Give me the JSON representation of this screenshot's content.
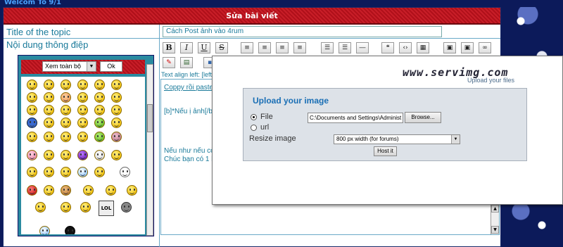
{
  "header": {
    "title": "Welcom To 9/1"
  },
  "panel": {
    "title": "Sửa bài viết"
  },
  "topic": {
    "label": "Title of the topic",
    "value": "Cách Post ảnh vào 4rum"
  },
  "message": {
    "label": "Nội dung thông điệp"
  },
  "toolbar": {
    "bold": "B",
    "italic": "I",
    "underline": "U",
    "strike": "S"
  },
  "emoticons": {
    "select_value": "Xem toàn bộ",
    "ok_label": "Ok",
    "picture_label": "LOL"
  },
  "editor": {
    "align_hint": "Text align left: [left",
    "lines": [
      "Coppy rồi paste",
      "[b]*Nếu ị ảnh[/b",
      "Nếu như nếu còn",
      "Chúc bạn có 1 bài"
    ]
  },
  "popup": {
    "logo": "www.servimg.com",
    "logo_sub": "Upload your files",
    "title": "Upload your image",
    "file_label": "File",
    "file_path": "C:\\Documents and Settings\\Administ",
    "browse_label": "Browse...",
    "url_label": "url",
    "resize_label": "Resize image",
    "resize_value": "800 px width (for forums)",
    "host_label": "Host it"
  },
  "colors": {
    "accent_red": "#c81e28",
    "label_teal": "#1a7a9a",
    "popup_title": "#1a6fb5"
  }
}
